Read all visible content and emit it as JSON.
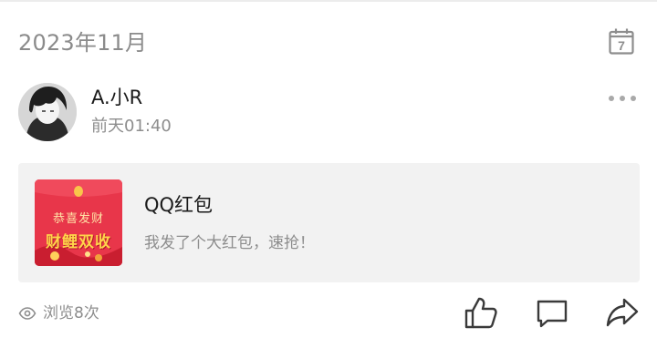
{
  "header": {
    "month": "2023年11月",
    "calendar_day": "7"
  },
  "post": {
    "author": "A.小R",
    "time": "前天01:40",
    "card": {
      "title": "QQ红包",
      "description": "我发了个大红包，速抢！",
      "thumbnail": {
        "greeting": "恭喜发财",
        "headline": "财鲤双收"
      }
    },
    "views": "浏览8次"
  },
  "colors": {
    "card_bg": "#f2f2f2",
    "muted_text": "#8d8d8d",
    "red_packet": "#e8364a"
  }
}
